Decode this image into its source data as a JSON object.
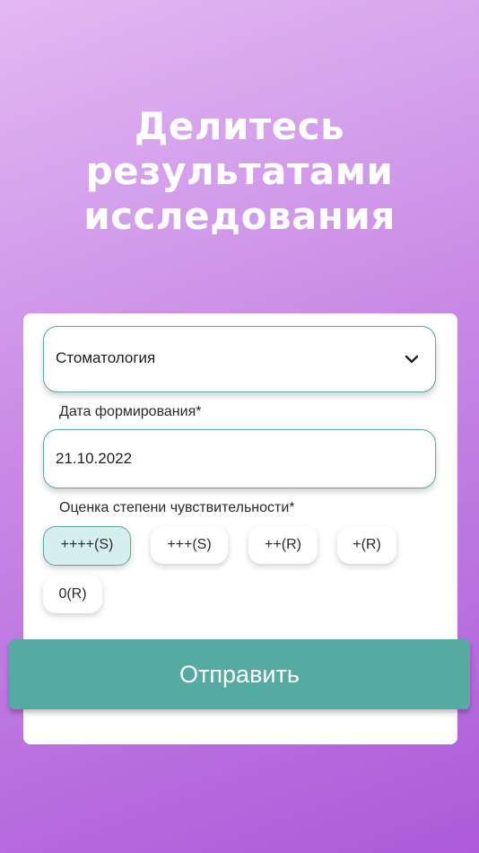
{
  "header": {
    "title_line1": "Делитесь",
    "title_line2": "результатами",
    "title_line3": "исследования"
  },
  "form": {
    "specialty": {
      "value": "Стоматология",
      "icon": "chevron-down-icon"
    },
    "date": {
      "label": "Дата формирования*",
      "value": "21.10.2022"
    },
    "sensitivity": {
      "label": "Оценка степени чувствительности*",
      "options": [
        "++++(S)",
        "+++(S)",
        "++(R)",
        "+(R)",
        "0(R)"
      ],
      "selected": "++++(S)"
    },
    "submit_label": "Отправить"
  },
  "colors": {
    "accent": "#55aba2",
    "selected_chip_bg": "#d6efec",
    "gradient_top": "#e2b8f2",
    "gradient_bottom": "#ad5bd9"
  }
}
